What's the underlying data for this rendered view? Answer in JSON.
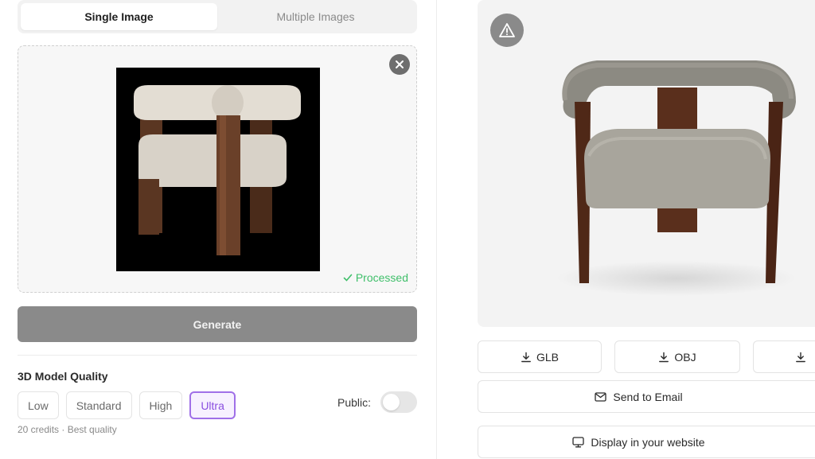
{
  "tabs": [
    {
      "label": "Single Image",
      "active": true
    },
    {
      "label": "Multiple Images",
      "active": false
    }
  ],
  "upload": {
    "status_icon": "check-icon",
    "status_text": "Processed",
    "remove_icon": "close-icon"
  },
  "generate_label": "Generate",
  "quality": {
    "label": "3D Model Quality",
    "options": [
      "Low",
      "Standard",
      "High",
      "Ultra"
    ],
    "selected": "Ultra",
    "credits_text": "20 credits · Best quality"
  },
  "public": {
    "label": "Public:",
    "enabled": false
  },
  "viewer": {
    "warning_icon": "warning-triangle-icon"
  },
  "downloads": [
    {
      "label": "GLB",
      "icon": "download-icon"
    },
    {
      "label": "OBJ",
      "icon": "download-icon"
    },
    {
      "label": "",
      "icon": "download-icon"
    }
  ],
  "send_email_label": "Send to Email",
  "display_website_label": "Display in your website",
  "colors": {
    "accent": "#a070e8",
    "success": "#3fbf6a",
    "button_disabled": "#8a8a8a"
  }
}
